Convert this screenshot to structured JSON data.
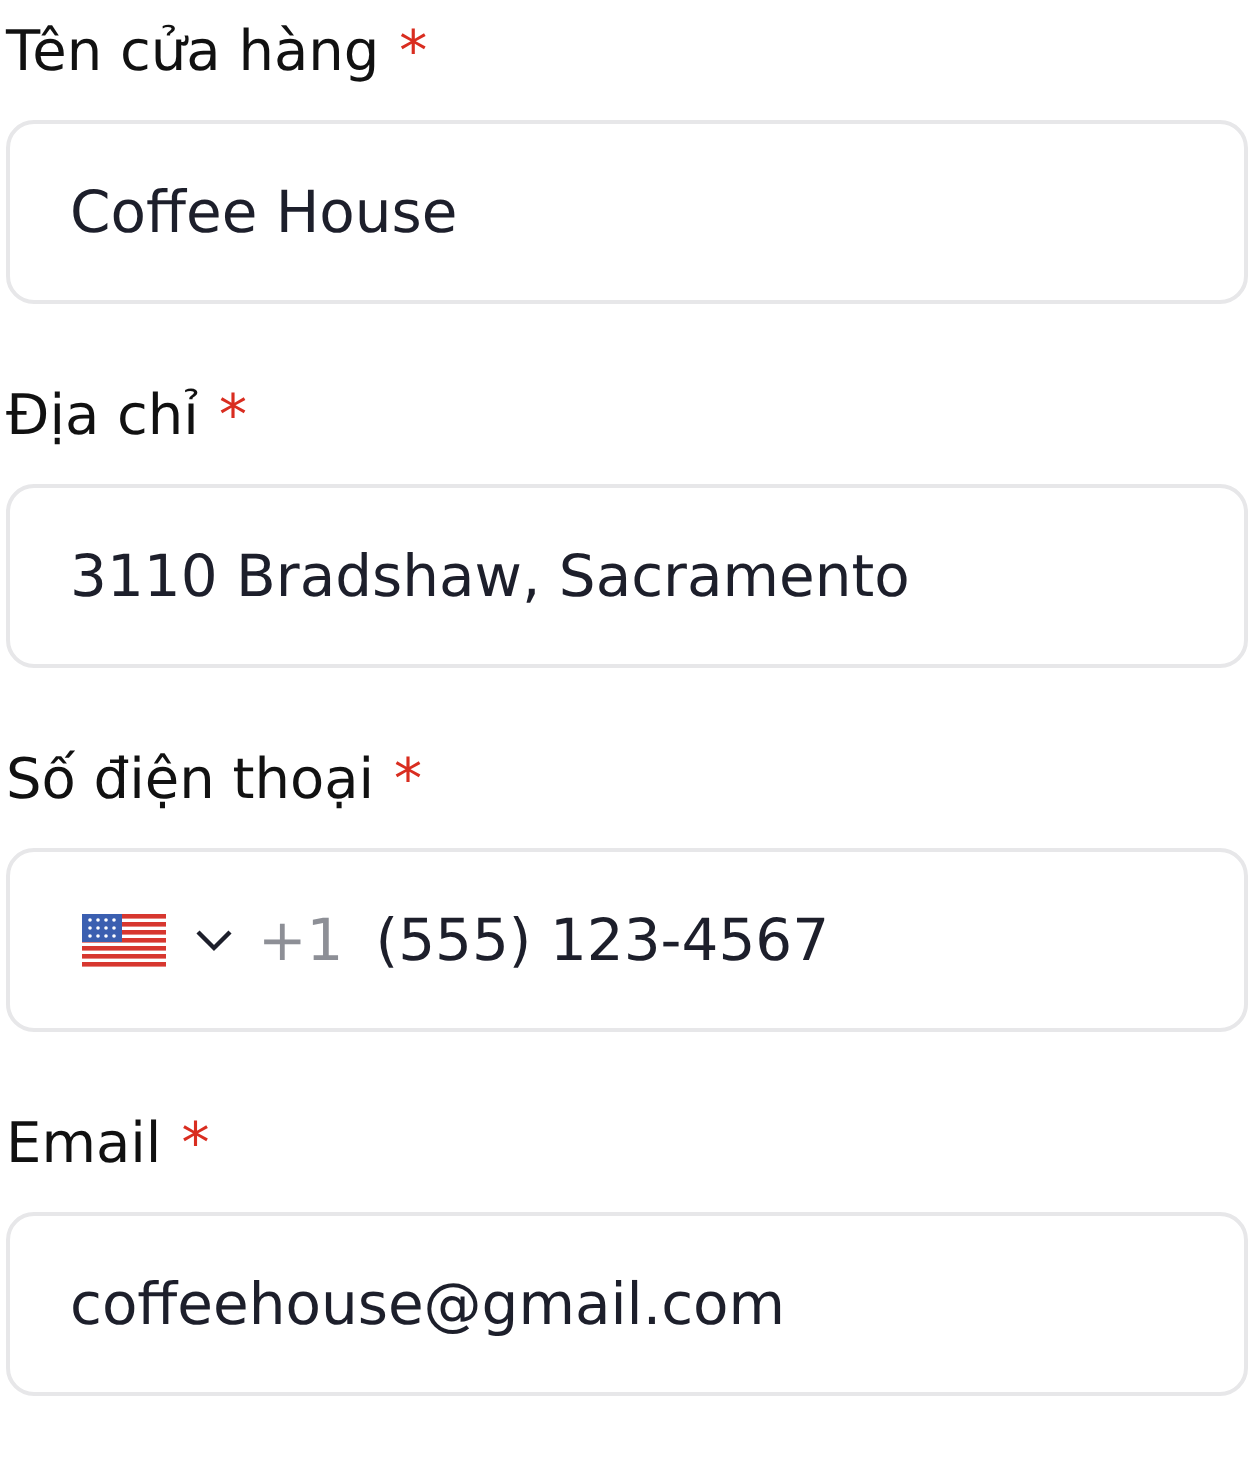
{
  "fields": [
    {
      "kind": "text",
      "label": "Tên cửa hàng",
      "required": true,
      "value": "Coffee House"
    },
    {
      "kind": "text",
      "label": "Địa chỉ",
      "required": true,
      "value": "3110 Bradshaw, Sacramento"
    },
    {
      "kind": "phone",
      "label": "Số điện thoại",
      "required": true,
      "dial_code": "+1",
      "value": "(555) 123-4567"
    },
    {
      "kind": "text",
      "label": "Email",
      "required": true,
      "value": "coffeehouse@gmail.com"
    }
  ],
  "required_mark": "*"
}
